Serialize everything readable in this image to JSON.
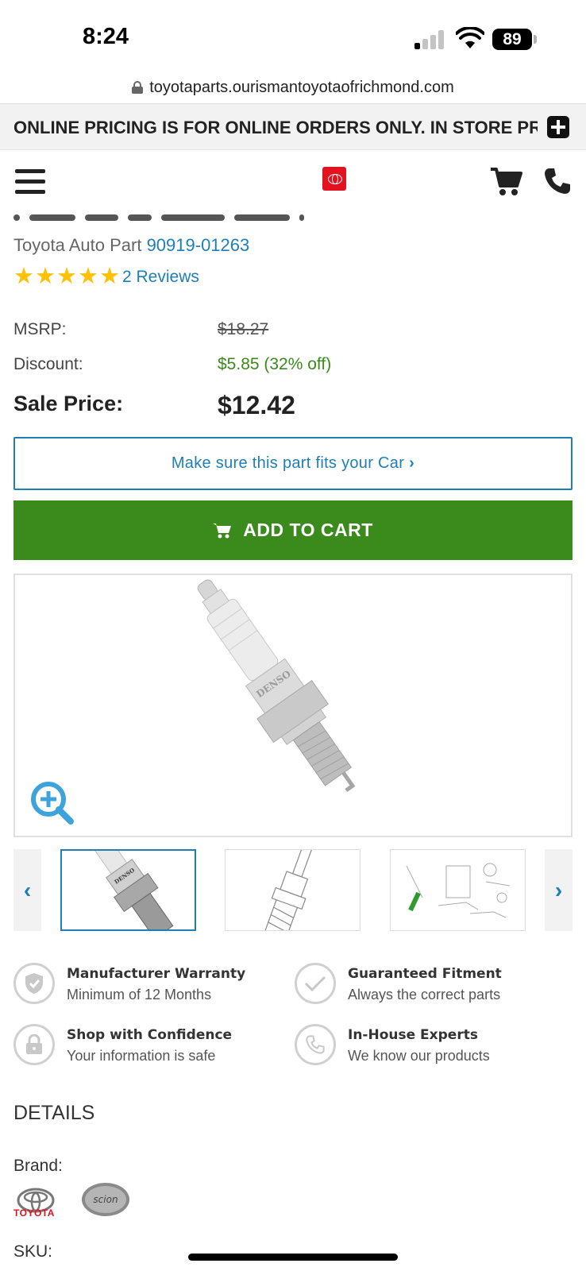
{
  "status_bar": {
    "time": "8:24",
    "battery": "89"
  },
  "browser": {
    "url": "toyotaparts.ourismantoyotaofrichmond.com"
  },
  "notice": {
    "text": "ONLINE PRICING IS FOR ONLINE ORDERS ONLY. IN STORE PRICING MAY VARY"
  },
  "header": {
    "menu_icon": "hamburger-icon",
    "logo_icon": "toyota-logo",
    "cart_icon": "cart-icon",
    "phone_icon": "phone-icon"
  },
  "product": {
    "part_prefix": "Toyota Auto Part",
    "part_number": "90919-01263",
    "rating_stars": 5,
    "reviews_text": "2 Reviews"
  },
  "pricing": {
    "msrp_label": "MSRP:",
    "msrp_value": "$18.27",
    "discount_label": "Discount:",
    "discount_value": "$5.85 (32% off)",
    "sale_label": "Sale Price:",
    "sale_value": "$12.42"
  },
  "actions": {
    "fit_label": "Make sure this part fits your Car",
    "add_to_cart_label": "ADD TO CART"
  },
  "gallery": {
    "main_image": "denso-spark-plug",
    "zoom_icon": "zoom-in-icon",
    "thumbnails": [
      "spark-plug-photo",
      "spark-plug-diagram",
      "ignition-system-diagram"
    ],
    "prev_icon": "chevron-left-icon",
    "next_icon": "chevron-right-icon"
  },
  "assurances": [
    {
      "title": "Manufacturer Warranty",
      "subtitle": "Minimum of 12 Months",
      "icon": "shield-check-icon"
    },
    {
      "title": "Guaranteed Fitment",
      "subtitle": "Always the correct parts",
      "icon": "checkmark-icon"
    },
    {
      "title": "Shop with Confidence",
      "subtitle": "Your information is safe",
      "icon": "lock-icon"
    },
    {
      "title": "In-House Experts",
      "subtitle": "We know our products",
      "icon": "phone-icon"
    }
  ],
  "details": {
    "heading": "DETAILS",
    "brand_label": "Brand:",
    "brands": [
      "TOYOTA",
      "scion"
    ],
    "sku_label": "SKU:"
  },
  "colors": {
    "link_blue": "#1e7fb8",
    "cart_green": "#3a8a1c",
    "toyota_red": "#e4121e",
    "star_yellow": "#ffc107"
  }
}
